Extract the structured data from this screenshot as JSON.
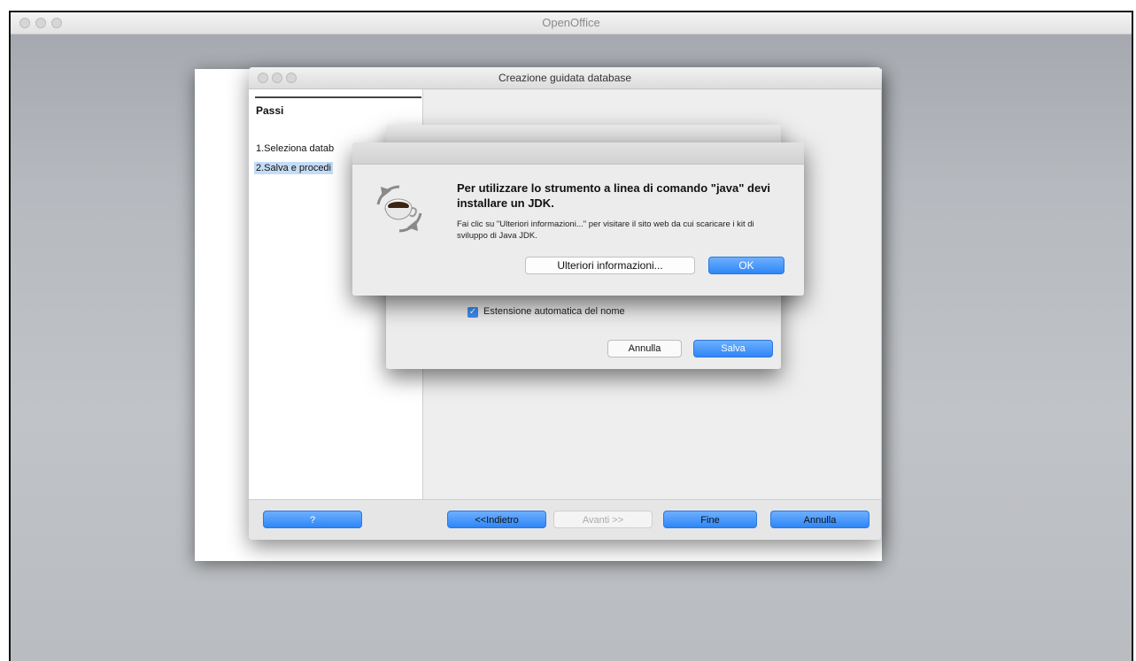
{
  "main_window": {
    "title": "OpenOffice"
  },
  "wizard": {
    "title": "Creazione guidata database",
    "steps_heading": "Passi",
    "steps": [
      "1.Seleziona datab",
      "2.Salva e procedi"
    ],
    "buttons": {
      "help": "?",
      "back": "<<Indietro",
      "next": "Avanti >>",
      "finish": "Fine",
      "cancel": "Annulla"
    }
  },
  "save_dialog": {
    "checkbox_label": "Estensione automatica del nome",
    "checkbox_checked": true,
    "buttons": {
      "cancel": "Annulla",
      "save": "Salva"
    }
  },
  "java_alert": {
    "heading": "Per utilizzare lo strumento a linea di comando \"java\" devi installare un JDK.",
    "body": "Fai clic su \"Ulteriori informazioni...\" per visitare il sito web da cui scaricare i kit di sviluppo di Java JDK.",
    "buttons": {
      "more_info": "Ulteriori informazioni...",
      "ok": "OK"
    },
    "icon": "java-coffee-icon"
  },
  "colors": {
    "accent_blue": "#2f86f6",
    "background_gray": "#b6babf"
  }
}
